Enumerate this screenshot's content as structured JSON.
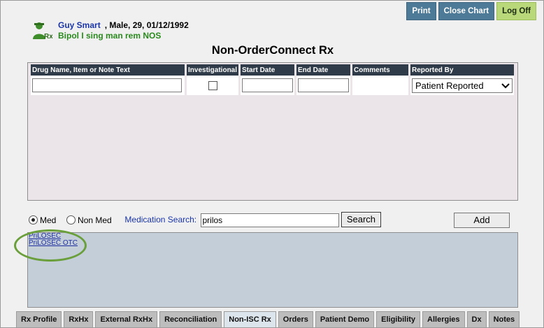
{
  "header": {
    "print_label": "Print",
    "close_chart_label": "Close Chart",
    "logoff_label": "Log Off"
  },
  "patient": {
    "name": "Guy Smart",
    "demographics": ", Male, 29, 01/12/1992",
    "diagnosis": "Bipol I sing man rem NOS",
    "avatar_icon": "patient-rx-icon"
  },
  "page_title": "Non-OrderConnect Rx",
  "grid": {
    "columns": [
      "Drug Name, Item or Note Text",
      "Investigational",
      "Start Date",
      "End Date",
      "Comments",
      "Reported By"
    ],
    "row": {
      "drug_name": "",
      "start_date": "",
      "end_date": "",
      "comments": "",
      "reported_by": "Patient Reported"
    }
  },
  "search": {
    "med_label": "Med",
    "non_med_label": "Non Med",
    "selected": "Med",
    "medication_search_label": "Medication Search:",
    "query": "prilos",
    "search_button": "Search",
    "add_button": "Add"
  },
  "results": [
    "PriLOSEC",
    "PriLOSEC OTC"
  ],
  "tabs": [
    {
      "label": "Rx Profile"
    },
    {
      "label": "RxHx"
    },
    {
      "label": "External RxHx"
    },
    {
      "label": "Reconciliation"
    },
    {
      "label": "Non-ISC Rx"
    },
    {
      "label": "Orders"
    },
    {
      "label": "Patient Demo"
    },
    {
      "label": "Eligibility"
    },
    {
      "label": "Allergies"
    },
    {
      "label": "Dx"
    },
    {
      "label": "Notes"
    }
  ],
  "active_tab": "Non-ISC Rx",
  "colors": {
    "accent_button": "#4d7a97",
    "logoff_button": "#b8d87a",
    "grid_header": "#2f3b48",
    "highlight_circle": "#6a9f3b"
  }
}
